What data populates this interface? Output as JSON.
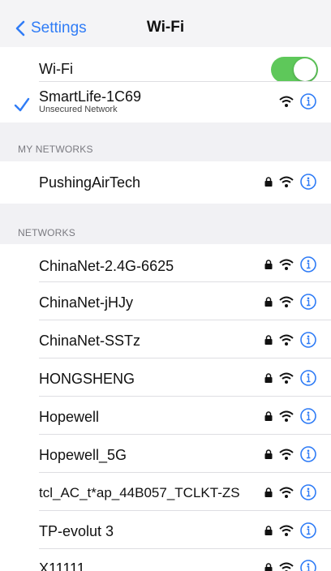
{
  "nav": {
    "back_label": "Settings",
    "title": "Wi-Fi"
  },
  "wifi_toggle": {
    "label": "Wi-Fi",
    "state": "on",
    "on_color": "#5ec85a"
  },
  "connected_network": {
    "name": "SmartLife-1C69",
    "subtitle": "Unsecured Network",
    "check_color": "#2f7cf6"
  },
  "my_networks": {
    "header": "MY NETWORKS",
    "items": [
      {
        "name": "PushingAirTech",
        "locked": true
      }
    ]
  },
  "networks": {
    "header": "NETWORKS",
    "items": [
      {
        "name": "ChinaNet-2.4G-6625",
        "locked": true
      },
      {
        "name": "ChinaNet-jHJy",
        "locked": true
      },
      {
        "name": "ChinaNet-SSTz",
        "locked": true
      },
      {
        "name": "HONGSHENG",
        "locked": true
      },
      {
        "name": "Hopewell",
        "locked": true
      },
      {
        "name": "Hopewell_5G",
        "locked": true
      },
      {
        "name": "tcl_AC_t*ap_44B057_TCLKT-ZS",
        "locked": true
      },
      {
        "name": "TP-evolut 3",
        "locked": true
      },
      {
        "name": "X11111",
        "locked": true
      }
    ]
  },
  "icons": {
    "back": "chevron-left-icon",
    "check": "checkmark-icon",
    "lock": "lock-icon",
    "wifi": "wifi-icon",
    "info": "info-icon"
  },
  "colors": {
    "accent": "#2f7cf6",
    "group_bg": "#f1f1f4",
    "nav_bg": "#f4f4f6"
  }
}
